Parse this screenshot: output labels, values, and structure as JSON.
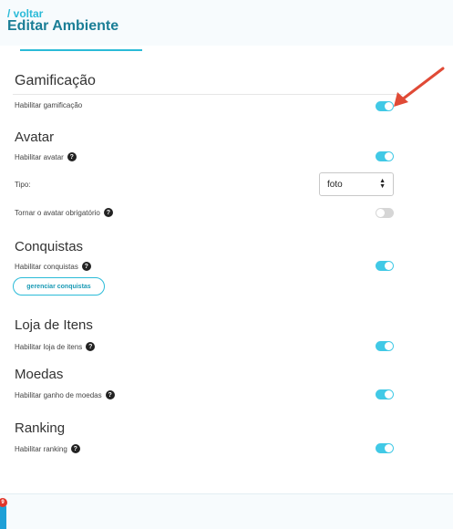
{
  "header": {
    "back_link": "/ voltar",
    "title": "Editar Ambiente"
  },
  "sections": {
    "gamification": {
      "title": "Gamificação",
      "enable_label": "Habilitar gamificação",
      "enabled": true
    },
    "avatar": {
      "title": "Avatar",
      "enable_label": "Habilitar avatar",
      "enabled": true,
      "type_label": "Tipo:",
      "type_value": "foto",
      "required_label": "Tornar o avatar obrigatório",
      "required": false
    },
    "achievements": {
      "title": "Conquistas",
      "enable_label": "Habilitar conquistas",
      "enabled": true,
      "manage_button": "gerenciar conquistas"
    },
    "item_store": {
      "title": "Loja de Itens",
      "enable_label": "Habilitar loja de itens",
      "enabled": true
    },
    "coins": {
      "title": "Moedas",
      "enable_label": "Habilitar ganho de moedas",
      "enabled": true
    },
    "ranking": {
      "title": "Ranking",
      "enable_label": "Habilitar ranking",
      "enabled": true
    }
  },
  "help_glyph": "?",
  "footer": {
    "badge_count": "9"
  },
  "colors": {
    "accent": "#41c9e6",
    "title": "#1a7e96",
    "arrow": "#e04a36"
  },
  "icons": [
    "help-icon",
    "chevron-updown-icon",
    "annotation-arrow-icon"
  ]
}
